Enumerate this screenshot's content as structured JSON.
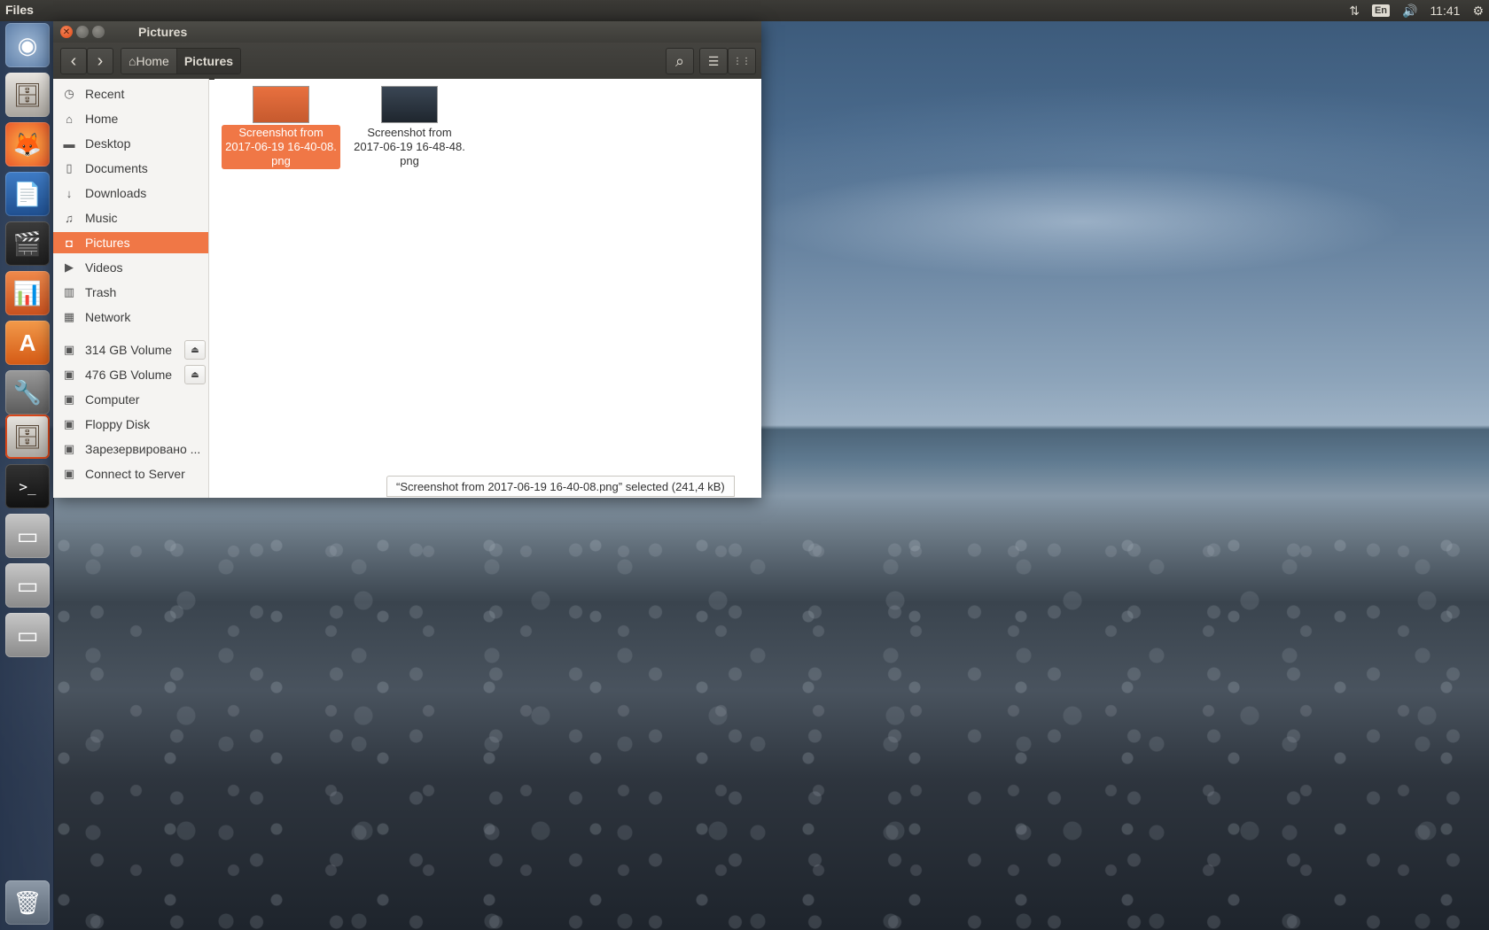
{
  "top_panel": {
    "app_name": "Files",
    "network_icon": "⇅",
    "keyboard_layout": "En",
    "volume_icon": "🔊",
    "clock": "11:41",
    "settings_icon": "⚙"
  },
  "launcher": {
    "items": [
      {
        "name": "ubuntu-dash-icon",
        "glyph": "◉"
      },
      {
        "name": "files-icon",
        "glyph": "🗄"
      },
      {
        "name": "firefox-icon",
        "glyph": "🦊"
      },
      {
        "name": "libreoffice-writer-icon",
        "glyph": "📄"
      },
      {
        "name": "video-editor-icon",
        "glyph": "🎬"
      },
      {
        "name": "libreoffice-impress-icon",
        "glyph": "📊"
      },
      {
        "name": "software-center-icon",
        "glyph": "A"
      },
      {
        "name": "system-settings-icon",
        "glyph": "🔧"
      },
      {
        "name": "files-active-icon",
        "glyph": "🗄"
      },
      {
        "name": "terminal-icon",
        "glyph": ">_"
      },
      {
        "name": "drive-icon-1",
        "glyph": "▭"
      },
      {
        "name": "drive-icon-2",
        "glyph": "▭"
      },
      {
        "name": "drive-icon-3",
        "glyph": "▭"
      },
      {
        "name": "trash-icon",
        "glyph": "🗑"
      }
    ]
  },
  "window": {
    "title": "Pictures",
    "toolbar": {
      "back_icon": "‹",
      "forward_icon": "›",
      "breadcrumbs": [
        "Home",
        "Pictures"
      ],
      "home_icon": "⌂",
      "search_icon": "⌕",
      "list_view_icon": "☰",
      "grid_view_icon": "⋮⋮"
    },
    "sidebar": {
      "places": [
        {
          "label": "Recent",
          "icon": "◷"
        },
        {
          "label": "Home",
          "icon": "⌂"
        },
        {
          "label": "Desktop",
          "icon": "▬"
        },
        {
          "label": "Documents",
          "icon": "▯"
        },
        {
          "label": "Downloads",
          "icon": "↓"
        },
        {
          "label": "Music",
          "icon": "♫"
        },
        {
          "label": "Pictures",
          "icon": "◘",
          "selected": true
        },
        {
          "label": "Videos",
          "icon": "▶"
        },
        {
          "label": "Trash",
          "icon": "▥"
        },
        {
          "label": "Network",
          "icon": "▦"
        }
      ],
      "devices": [
        {
          "label": "314 GB Volume",
          "icon": "▣",
          "eject": "⏏"
        },
        {
          "label": "476 GB Volume",
          "icon": "▣",
          "eject": "⏏"
        },
        {
          "label": "Computer",
          "icon": "▣"
        },
        {
          "label": "Floppy Disk",
          "icon": "▣"
        },
        {
          "label": "Зарезервировано ...",
          "icon": "▣"
        },
        {
          "label": "Connect to Server",
          "icon": "▣"
        }
      ]
    },
    "files": [
      {
        "name": "Screenshot from 2017-06-19 16-40-08.png",
        "line1": "Screenshot from",
        "line2": "2017-06-19 16-40-08.",
        "line3": "png",
        "selected": true,
        "thumb_color": "#e8703f"
      },
      {
        "name": "Screenshot from 2017-06-19 16-48-48.png",
        "line1": "Screenshot from",
        "line2": "2017-06-19 16-48-48.",
        "line3": "png",
        "selected": false,
        "thumb_color": "#2b3440"
      }
    ],
    "status": "“Screenshot from 2017-06-19 16-40-08.png” selected  (241,4 kB)"
  },
  "colors": {
    "accent": "#f07746",
    "panel": "#3c3b37",
    "close_button": "#df4a16"
  }
}
